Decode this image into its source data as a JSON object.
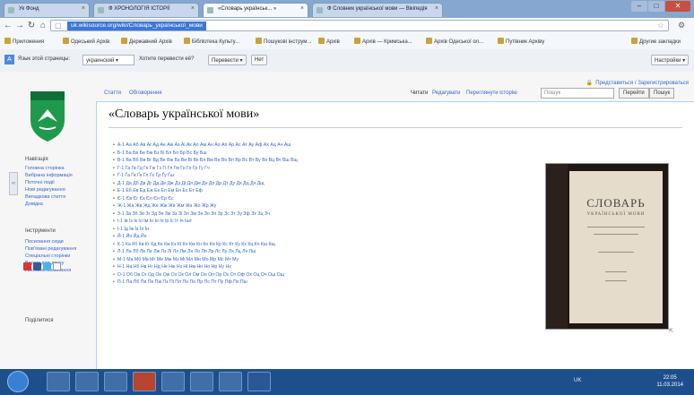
{
  "browser": {
    "tabs": [
      {
        "label": "Ук Фонд"
      },
      {
        "label": "Ф ХРОНОЛОГІЯ ІСТОРІЇ"
      },
      {
        "label": "«Словарь українськ... »"
      },
      {
        "label": "Ф Словник української мови — Вікіпедія"
      }
    ],
    "url": "uk.wikisource.org/wiki/Словарь_української_мови",
    "bookmarks": [
      "Приложения",
      "Одеський Архів",
      "Державний Архів",
      "Бібліотека Культу...",
      "Пошукові інструм...",
      "Архів",
      "Архів — Кримська... ",
      "Архів Одеської ол...",
      "Путівник Архіву"
    ],
    "bookmarks_other": "Другие закладки",
    "translate": {
      "prefix": "Язык этой страницы:",
      "language": "украинский",
      "question": "Хотите перевести её?",
      "translate_button": "Перевести",
      "no_button": "Нет",
      "settings": "Настройки"
    }
  },
  "wiki": {
    "userbar": "Представиться / Зарегистрироваться",
    "ns_tabs": [
      "Стаття",
      "Обговорення"
    ],
    "actions": [
      "Читати",
      "Редагувати",
      "Переглянути історію"
    ],
    "search_placeholder": "Пошук",
    "search_buttons": [
      "Перейти",
      "Пошук"
    ],
    "title": "«Словарь української мови»",
    "sidebar": {
      "nav_head": "Навігація",
      "nav": [
        "Головна сторінка",
        "Вибрана інформація",
        "Поточні події",
        "Нові редагування",
        "Випадкова стаття",
        "Довідка"
      ],
      "tools_head": "Інструменти",
      "tools": [
        "Посилання сюди",
        "Пов'язані редагування",
        "Спеціальні сторінки",
        "Версія для друку",
        "Постійне посилання"
      ],
      "share_head": "Поділитися"
    },
    "letters": [
      "А-1 Аа Аб Ав Аг Ад Ае Аж Аз Аі Ак Ал Ам Ан Ао Ап Ар Ас Ат Ау Аф Ах Ац Ач Аш",
      "Б-1 Ба Бв Бе Бж Бз Бі Бл Бо Бр Бс Бу Бш",
      "В-1 Ва Вб Вв Вг Вд Ве Вж Вз Ви Ві Вк Вл Вм Вн Во Вп Вр Вс Вт Ву Вх Вц Вч Вш Вщ",
      "Г-1 Га Гв Гд Ге Гж Гз Гі Гл Гм Гн Го Гр Гу Гч",
      "Ґ-1 Ґа Ґв Ґе Ґл Ґо Ґр Ґу Ґш",
      "Д-1 Да Дб Дв Дг Дд Де Дж Дз Ді Дл Дм Дн До Др Дт Ду Дх Дц Дч Дщ",
      "Е-1 Еб Ев Ед Еж Ек Ел Ем Ен Ес Ет Еф",
      "Є-1 Єв Єг Єк Єл Єн Єр Єс",
      "Ж-1 Жа Жв Жд Же Жж Жи Жм Жн Жо Жр Жу",
      "З-1 За Зб Зв Зг Зд Зе Зж Зз Зі Зл Зм Зн Зо Зп Зр Зс Зт Зу Зф Зх Зц Зч",
      "І-1 Ів Із Ік Іл Ім Ін Іо Іп Ір Іс Іт Іч Ішт",
      "Ї-1 Їд Їж Їз Їл Їн",
      "Й-1 Йо Йд Йн",
      "К-1 Ка Кб Кв Кг Кд Ке Кж Кз Кі Кл Км Кн Ко Кп Кр Кс Кт Ку Кх Кц Кч Кш Кщ",
      "Л-1 Ла Лб Лв Ле Лж Лз Лі Лл Лм Лн Ло Лп Лр Лс Лу Лх Лц Лч Лш",
      "М-1 Ма Мб Мв Мг Ме Мж Мз Мі Мл Мн Мо Мр Мс Мт Му",
      "Н-1 На Нб Нв Нг Нд Не Нж Нз Ні Нм Нн Но Нр Ну Нх",
      "О-1 Об Ов Ог Од Ое Ож Оз Ок Ол Ом Он Оп Ор Ос От Оф Ох Оц Оч Ош Ощ",
      "П-1 Па Пб Пв Пе Пж Пз Пі Пл Пн По Пр Пс Пт Пу Пф Пх Пш"
    ]
  },
  "book": {
    "title": "СЛОВАРЬ",
    "subtitle": "УКРАЇНСЬКОЇ МОВИ"
  },
  "taskbar": {
    "time": "22:05",
    "date": "11.03.2014",
    "tray_lang": "UK"
  }
}
